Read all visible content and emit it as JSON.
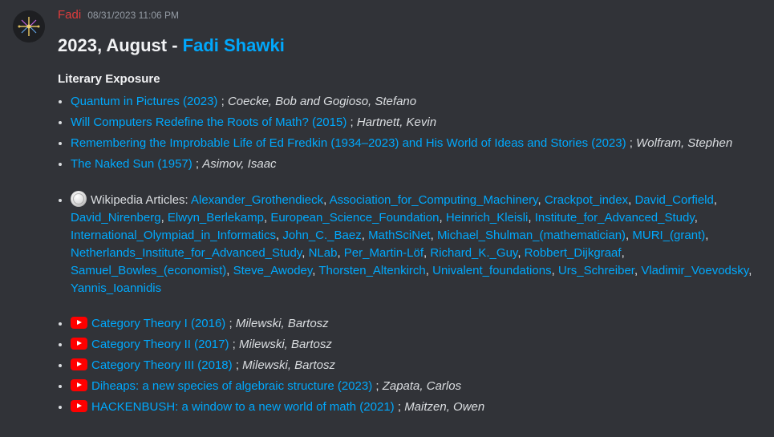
{
  "message": {
    "username": "Fadi",
    "timestamp": "08/31/2023 11:06 PM",
    "title_prefix": "2023, August - ",
    "title_link": "Fadi Shawki",
    "section_heading": "Literary Exposure"
  },
  "literary": [
    {
      "title": "Quantum in Pictures (2023)",
      "sep": " ; ",
      "author": "Coecke, Bob and Gogioso, Stefano"
    },
    {
      "title": "Will Computers Redefine the Roots of Math? (2015)",
      "sep": " ; ",
      "author": "Hartnett, Kevin"
    },
    {
      "title": "Remembering the Improbable Life of Ed Fredkin (1934–2023) and His World of Ideas and Stories (2023)",
      "sep": " ; ",
      "author": "Wolfram, Stephen"
    },
    {
      "title": "The Naked Sun (1957)",
      "sep": " ; ",
      "author": "Asimov, Isaac"
    }
  ],
  "wikipedia": {
    "icon": "wikipedia-globe-icon",
    "label": "Wikipedia Articles: ",
    "articles": [
      "Alexander_Grothendieck",
      "Association_for_Computing_Machinery",
      "Crackpot_index",
      "David_Corfield",
      "David_Nirenberg",
      "Elwyn_Berlekamp",
      "European_Science_Foundation",
      "Heinrich_Kleisli",
      "Institute_for_Advanced_Study",
      "International_Olympiad_in_Informatics",
      "John_C._Baez",
      "MathSciNet",
      "Michael_Shulman_(mathematician)",
      "MURI_(grant)",
      "Netherlands_Institute_for_Advanced_Study",
      "NLab",
      "Per_Martin-Löf",
      "Richard_K._Guy",
      "Robbert_Dijkgraaf",
      "Samuel_Bowles_(economist)",
      "Steve_Awodey",
      "Thorsten_Altenkirch",
      "Univalent_foundations",
      "Urs_Schreiber",
      "Vladimir_Voevodsky",
      "Yannis_Ioannidis"
    ]
  },
  "videos": [
    {
      "title": "Category Theory I (2016)",
      "sep": " ; ",
      "author": "Milewski, Bartosz"
    },
    {
      "title": "Category Theory II (2017)",
      "sep": " ; ",
      "author": "Milewski, Bartosz"
    },
    {
      "title": "Category Theory III (2018)",
      "sep": " ; ",
      "author": "Milewski, Bartosz"
    },
    {
      "title": "Diheaps: a new species of algebraic structure (2023)",
      "sep": " ; ",
      "author": "Zapata, Carlos"
    },
    {
      "title": "HACKENBUSH: a window to a new world of math (2021)",
      "sep": " ; ",
      "author": "Maitzen, Owen"
    }
  ],
  "colors": {
    "background": "#313338",
    "link": "#00a8fc",
    "username": "#e23c3c",
    "youtube": "#ff0000"
  }
}
